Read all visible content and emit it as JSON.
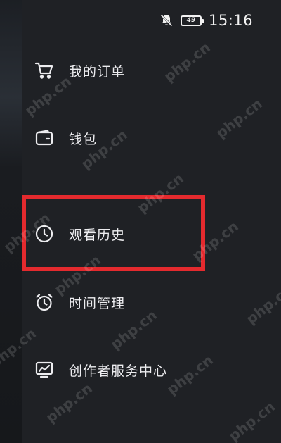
{
  "status_bar": {
    "time": "15:16",
    "battery_level": "49",
    "icons": [
      "mute-bell-icon",
      "battery-icon"
    ]
  },
  "menu": {
    "items": [
      {
        "label": "我的订单",
        "icon": "cart-icon"
      },
      {
        "label": "钱包",
        "icon": "wallet-icon"
      },
      {
        "label": "观看历史",
        "icon": "clock-icon"
      },
      {
        "label": "时间管理",
        "icon": "alarm-icon"
      },
      {
        "label": "创作者服务中心",
        "icon": "chart-monitor-icon"
      }
    ],
    "highlighted_index": 2
  },
  "watermark": {
    "text": "php.cn"
  },
  "colors": {
    "background": "#1f2125",
    "text": "#ededf0",
    "highlight": "#e42a2e"
  }
}
